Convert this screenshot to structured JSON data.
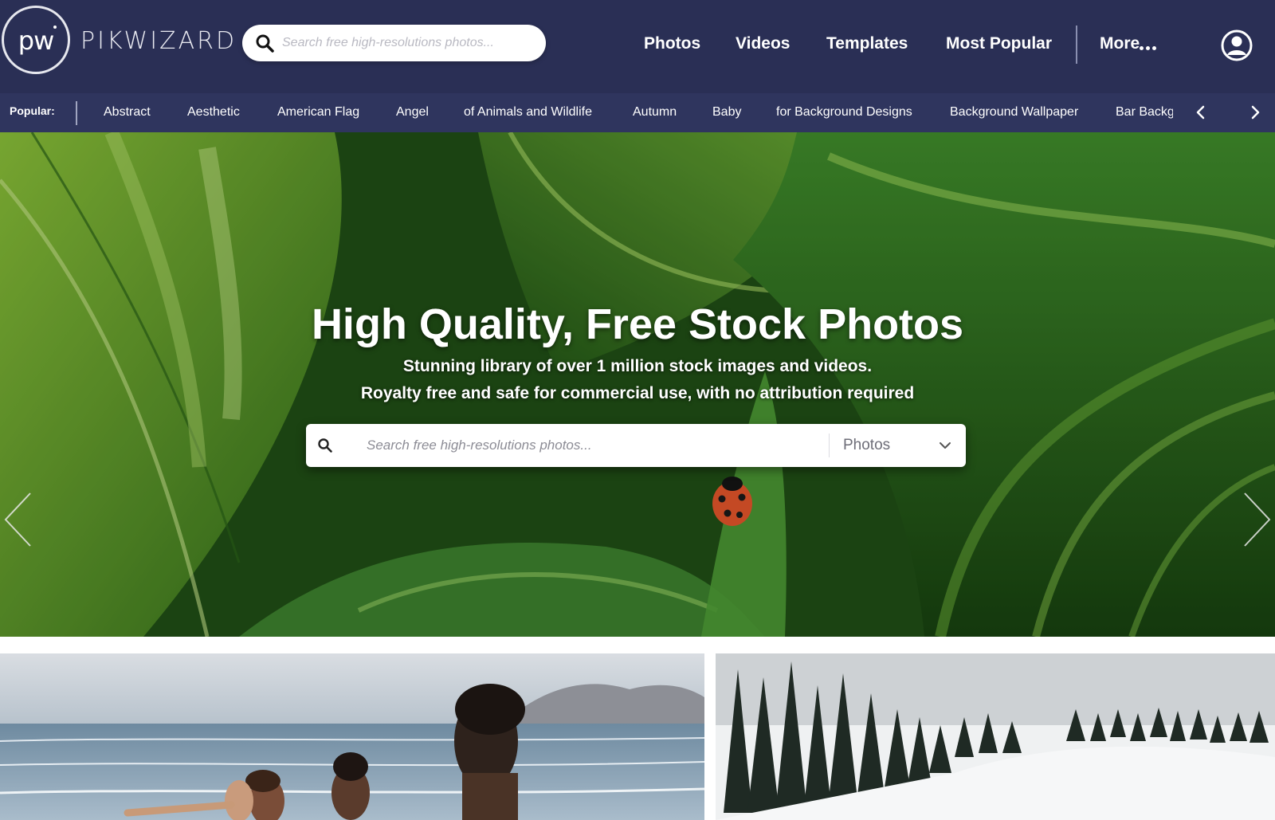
{
  "header": {
    "logo_text": "pw",
    "brand": "PIKWIZARD",
    "search_placeholder": "Search free high-resolutions photos...",
    "nav": [
      "Photos",
      "Videos",
      "Templates",
      "Most Popular"
    ],
    "more_label": "More"
  },
  "popular": {
    "label": "Popular:",
    "tags": [
      "Abstract",
      "Aesthetic",
      "American Flag",
      "Angel",
      "of Animals and Wildlife",
      "Autumn",
      "Baby",
      "for Background Designs",
      "Background Wallpaper",
      "Bar Backg"
    ]
  },
  "hero": {
    "title": "High Quality, Free Stock Photos",
    "subtitle_1": "Stunning library of over 1 million stock images and videos.",
    "subtitle_2": "Royalty free and safe for commercial use, with no attribution required",
    "search_placeholder": "Search free high-resolutions photos...",
    "type_selected": "Photos"
  },
  "colors": {
    "header_bg": "#2a2f55",
    "popular_bg": "#2f355e",
    "text_on_dark": "#ffffff"
  },
  "icons": [
    "search-icon",
    "user-icon",
    "chevron-left-icon",
    "chevron-right-icon",
    "chevron-down-icon",
    "more-dots-icon"
  ]
}
